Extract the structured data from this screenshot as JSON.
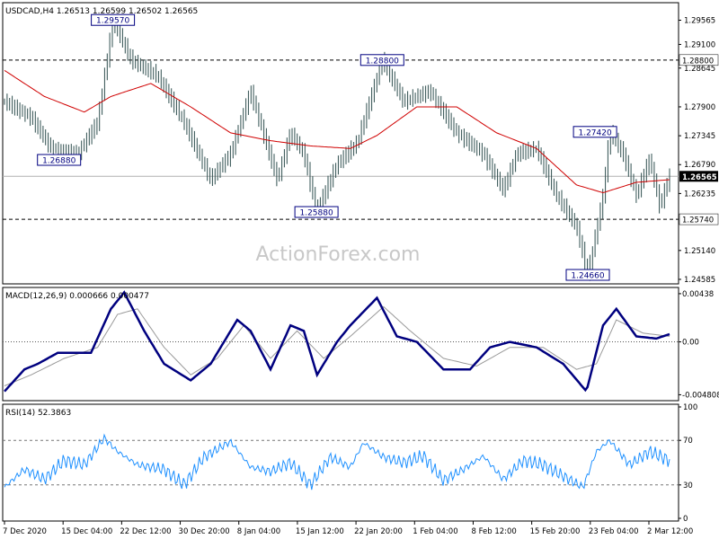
{
  "chart_data": [
    {
      "type": "ohlc",
      "header": "USDCAD,H4  1.26513 1.26599 1.26502 1.26565",
      "watermark": "ActionForex.com",
      "ylim": [
        1.2455,
        1.2985
      ],
      "y_ticks": [
        "1.29565",
        "1.29100",
        "1.28645",
        "1.27900",
        "1.27345",
        "1.26790",
        "1.26235",
        "1.25140",
        "1.24585"
      ],
      "x_ticks": [
        "7 Dec 2020",
        "15 Dec 04:00",
        "22 Dec 12:00",
        "30 Dec 20:00",
        "8 Jan 04:00",
        "15 Jan 12:00",
        "22 Jan 20:00",
        "1 Feb 04:00",
        "8 Feb 12:00",
        "15 Feb 20:00",
        "23 Feb 04:00",
        "2 Mar 12:00"
      ],
      "level_lines": [
        {
          "value": 1.288,
          "label": "1.28800"
        },
        {
          "value": 1.2574,
          "label": "1.25740"
        }
      ],
      "current_price": {
        "value": 1.26565,
        "label": "1.26565"
      },
      "annotations": [
        {
          "label": "1.29570",
          "value": 1.2957,
          "x_frac": 0.163
        },
        {
          "label": "1.28800",
          "value": 1.288,
          "x_frac": 0.568
        },
        {
          "label": "1.26880",
          "value": 1.2688,
          "x_frac": 0.082
        },
        {
          "label": "1.25880",
          "value": 1.2588,
          "x_frac": 0.469
        },
        {
          "label": "1.27420",
          "value": 1.2742,
          "x_frac": 0.888
        },
        {
          "label": "1.24660",
          "value": 1.2466,
          "x_frac": 0.877
        }
      ],
      "price_path": [
        {
          "t": 0.0,
          "v": 1.28
        },
        {
          "t": 0.04,
          "v": 1.277
        },
        {
          "t": 0.07,
          "v": 1.271
        },
        {
          "t": 0.11,
          "v": 1.27
        },
        {
          "t": 0.14,
          "v": 1.276
        },
        {
          "t": 0.163,
          "v": 1.2957
        },
        {
          "t": 0.19,
          "v": 1.288
        },
        {
          "t": 0.23,
          "v": 1.285
        },
        {
          "t": 0.27,
          "v": 1.276
        },
        {
          "t": 0.31,
          "v": 1.265
        },
        {
          "t": 0.34,
          "v": 1.27
        },
        {
          "t": 0.37,
          "v": 1.282
        },
        {
          "t": 0.41,
          "v": 1.265
        },
        {
          "t": 0.43,
          "v": 1.274
        },
        {
          "t": 0.45,
          "v": 1.27
        },
        {
          "t": 0.469,
          "v": 1.2588
        },
        {
          "t": 0.5,
          "v": 1.268
        },
        {
          "t": 0.53,
          "v": 1.272
        },
        {
          "t": 0.568,
          "v": 1.288
        },
        {
          "t": 0.6,
          "v": 1.28
        },
        {
          "t": 0.64,
          "v": 1.282
        },
        {
          "t": 0.68,
          "v": 1.274
        },
        {
          "t": 0.72,
          "v": 1.27
        },
        {
          "t": 0.75,
          "v": 1.263
        },
        {
          "t": 0.77,
          "v": 1.27
        },
        {
          "t": 0.8,
          "v": 1.271
        },
        {
          "t": 0.83,
          "v": 1.262
        },
        {
          "t": 0.86,
          "v": 1.256
        },
        {
          "t": 0.877,
          "v": 1.2466
        },
        {
          "t": 0.9,
          "v": 1.262
        },
        {
          "t": 0.91,
          "v": 1.2742
        },
        {
          "t": 0.93,
          "v": 1.27
        },
        {
          "t": 0.95,
          "v": 1.262
        },
        {
          "t": 0.97,
          "v": 1.269
        },
        {
          "t": 0.985,
          "v": 1.26
        },
        {
          "t": 1.0,
          "v": 1.2657
        }
      ],
      "ma_path": [
        {
          "t": 0.0,
          "v": 1.286
        },
        {
          "t": 0.06,
          "v": 1.281
        },
        {
          "t": 0.12,
          "v": 1.278
        },
        {
          "t": 0.16,
          "v": 1.281
        },
        {
          "t": 0.22,
          "v": 1.2835
        },
        {
          "t": 0.28,
          "v": 1.279
        },
        {
          "t": 0.34,
          "v": 1.274
        },
        {
          "t": 0.4,
          "v": 1.2725
        },
        {
          "t": 0.46,
          "v": 1.2715
        },
        {
          "t": 0.52,
          "v": 1.271
        },
        {
          "t": 0.56,
          "v": 1.2735
        },
        {
          "t": 0.62,
          "v": 1.279
        },
        {
          "t": 0.68,
          "v": 1.279
        },
        {
          "t": 0.74,
          "v": 1.274
        },
        {
          "t": 0.8,
          "v": 1.271
        },
        {
          "t": 0.86,
          "v": 1.264
        },
        {
          "t": 0.9,
          "v": 1.2625
        },
        {
          "t": 0.95,
          "v": 1.2645
        },
        {
          "t": 1.0,
          "v": 1.265
        }
      ]
    },
    {
      "type": "line",
      "title": "MACD(12,26,9) 0.000666 0.000477",
      "ylim": [
        -0.0051,
        0.0047
      ],
      "y_ticks": [
        "0.00438",
        "0.00",
        "-0.004808"
      ],
      "series": [
        {
          "role": "macd",
          "points": [
            {
              "t": 0.0,
              "v": -0.0045
            },
            {
              "t": 0.03,
              "v": -0.0025
            },
            {
              "t": 0.05,
              "v": -0.002
            },
            {
              "t": 0.08,
              "v": -0.001
            },
            {
              "t": 0.13,
              "v": -0.001
            },
            {
              "t": 0.16,
              "v": 0.003
            },
            {
              "t": 0.18,
              "v": 0.0045
            },
            {
              "t": 0.21,
              "v": 0.001
            },
            {
              "t": 0.24,
              "v": -0.002
            },
            {
              "t": 0.28,
              "v": -0.0035
            },
            {
              "t": 0.31,
              "v": -0.002
            },
            {
              "t": 0.35,
              "v": 0.002
            },
            {
              "t": 0.37,
              "v": 0.001
            },
            {
              "t": 0.4,
              "v": -0.0025
            },
            {
              "t": 0.43,
              "v": 0.0015
            },
            {
              "t": 0.45,
              "v": 0.001
            },
            {
              "t": 0.47,
              "v": -0.003
            },
            {
              "t": 0.5,
              "v": 0.0
            },
            {
              "t": 0.52,
              "v": 0.0015
            },
            {
              "t": 0.56,
              "v": 0.004
            },
            {
              "t": 0.59,
              "v": 0.0005
            },
            {
              "t": 0.62,
              "v": 0.0
            },
            {
              "t": 0.66,
              "v": -0.0025
            },
            {
              "t": 0.7,
              "v": -0.0025
            },
            {
              "t": 0.73,
              "v": -0.0005
            },
            {
              "t": 0.76,
              "v": 0.0
            },
            {
              "t": 0.8,
              "v": -0.0005
            },
            {
              "t": 0.84,
              "v": -0.002
            },
            {
              "t": 0.875,
              "v": -0.0045
            },
            {
              "t": 0.9,
              "v": 0.0015
            },
            {
              "t": 0.92,
              "v": 0.003
            },
            {
              "t": 0.95,
              "v": 0.0005
            },
            {
              "t": 0.98,
              "v": 0.0003
            },
            {
              "t": 1.0,
              "v": 0.0007
            }
          ]
        },
        {
          "role": "signal",
          "points": [
            {
              "t": 0.0,
              "v": -0.004
            },
            {
              "t": 0.04,
              "v": -0.003
            },
            {
              "t": 0.09,
              "v": -0.0015
            },
            {
              "t": 0.14,
              "v": -0.0005
            },
            {
              "t": 0.17,
              "v": 0.0025
            },
            {
              "t": 0.2,
              "v": 0.003
            },
            {
              "t": 0.24,
              "v": -0.0005
            },
            {
              "t": 0.28,
              "v": -0.003
            },
            {
              "t": 0.32,
              "v": -0.0015
            },
            {
              "t": 0.36,
              "v": 0.0015
            },
            {
              "t": 0.4,
              "v": -0.0015
            },
            {
              "t": 0.44,
              "v": 0.001
            },
            {
              "t": 0.48,
              "v": -0.0015
            },
            {
              "t": 0.52,
              "v": 0.0005
            },
            {
              "t": 0.57,
              "v": 0.0032
            },
            {
              "t": 0.61,
              "v": 0.001
            },
            {
              "t": 0.66,
              "v": -0.0015
            },
            {
              "t": 0.71,
              "v": -0.0022
            },
            {
              "t": 0.76,
              "v": -0.0005
            },
            {
              "t": 0.81,
              "v": -0.0005
            },
            {
              "t": 0.86,
              "v": -0.0025
            },
            {
              "t": 0.89,
              "v": -0.002
            },
            {
              "t": 0.92,
              "v": 0.002
            },
            {
              "t": 0.96,
              "v": 0.0008
            },
            {
              "t": 1.0,
              "v": 0.0005
            }
          ]
        }
      ]
    },
    {
      "type": "line",
      "title": "RSI(14) 52.3863",
      "ylim": [
        0,
        100
      ],
      "y_ticks": [
        "100",
        "70",
        "30",
        "0"
      ],
      "levels": [
        70,
        30
      ],
      "series": [
        {
          "role": "rsi",
          "points": [
            {
              "t": 0.0,
              "v": 28
            },
            {
              "t": 0.03,
              "v": 44
            },
            {
              "t": 0.06,
              "v": 35
            },
            {
              "t": 0.09,
              "v": 52
            },
            {
              "t": 0.12,
              "v": 48
            },
            {
              "t": 0.15,
              "v": 72
            },
            {
              "t": 0.17,
              "v": 60
            },
            {
              "t": 0.2,
              "v": 48
            },
            {
              "t": 0.24,
              "v": 44
            },
            {
              "t": 0.27,
              "v": 30
            },
            {
              "t": 0.3,
              "v": 55
            },
            {
              "t": 0.34,
              "v": 69
            },
            {
              "t": 0.37,
              "v": 46
            },
            {
              "t": 0.4,
              "v": 42
            },
            {
              "t": 0.43,
              "v": 50
            },
            {
              "t": 0.46,
              "v": 30
            },
            {
              "t": 0.49,
              "v": 55
            },
            {
              "t": 0.52,
              "v": 46
            },
            {
              "t": 0.54,
              "v": 68
            },
            {
              "t": 0.57,
              "v": 55
            },
            {
              "t": 0.6,
              "v": 50
            },
            {
              "t": 0.63,
              "v": 56
            },
            {
              "t": 0.66,
              "v": 34
            },
            {
              "t": 0.69,
              "v": 44
            },
            {
              "t": 0.72,
              "v": 56
            },
            {
              "t": 0.75,
              "v": 35
            },
            {
              "t": 0.78,
              "v": 52
            },
            {
              "t": 0.81,
              "v": 48
            },
            {
              "t": 0.84,
              "v": 38
            },
            {
              "t": 0.87,
              "v": 28
            },
            {
              "t": 0.89,
              "v": 60
            },
            {
              "t": 0.91,
              "v": 70
            },
            {
              "t": 0.94,
              "v": 48
            },
            {
              "t": 0.97,
              "v": 60
            },
            {
              "t": 1.0,
              "v": 52
            }
          ]
        }
      ]
    }
  ],
  "colors": {
    "background": "#ffffff",
    "frame": "#000000",
    "bars": "#2f4f4f",
    "moving_average": "#d00000",
    "macd_line": "#00007f",
    "signal_line": "#999999",
    "rsi_line": "#1e90ff",
    "level_line": "#000000",
    "current_price_bg": "#000000",
    "label_box_border": "#000080",
    "watermark": "#c8c8c8"
  }
}
